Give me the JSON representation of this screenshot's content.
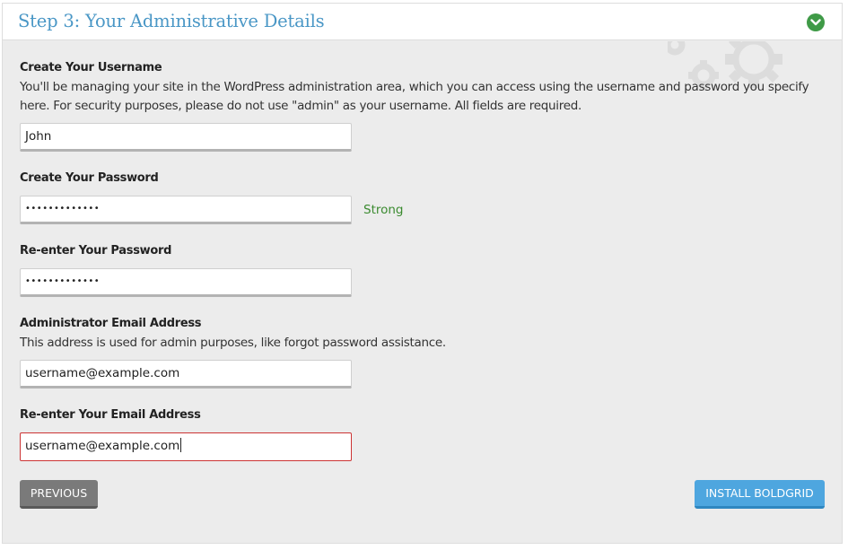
{
  "step": {
    "title": "Step 3: Your Administrative Details"
  },
  "username": {
    "label": "Create Your Username",
    "help": "You'll be managing your site in the WordPress administration area, which you can access using the username and password you specify here. For security purposes, please do not use \"admin\" as your username. All fields are required.",
    "value": "John"
  },
  "password": {
    "label": "Create Your Password",
    "value": "•••••••••••••",
    "strength": "Strong",
    "strength_color": "#3a8a2f"
  },
  "password_confirm": {
    "label": "Re-enter Your Password",
    "value": "•••••••••••••"
  },
  "email": {
    "label": "Administrator Email Address",
    "help": "This address is used for admin purposes, like forgot password assistance.",
    "value": "username@example.com"
  },
  "email_confirm": {
    "label": "Re-enter Your Email Address",
    "value": "username@example.com"
  },
  "buttons": {
    "previous": "Previous",
    "install": "Install BoldGrid"
  },
  "colors": {
    "title": "#4a97c6",
    "collapse": "#3f9a47",
    "install_button": "#4ea6df",
    "previous_button": "#7a7a7a",
    "error_border": "#cc3333"
  },
  "icons": {
    "collapse": "chevron-down-icon",
    "decoration": "gears-icon"
  }
}
